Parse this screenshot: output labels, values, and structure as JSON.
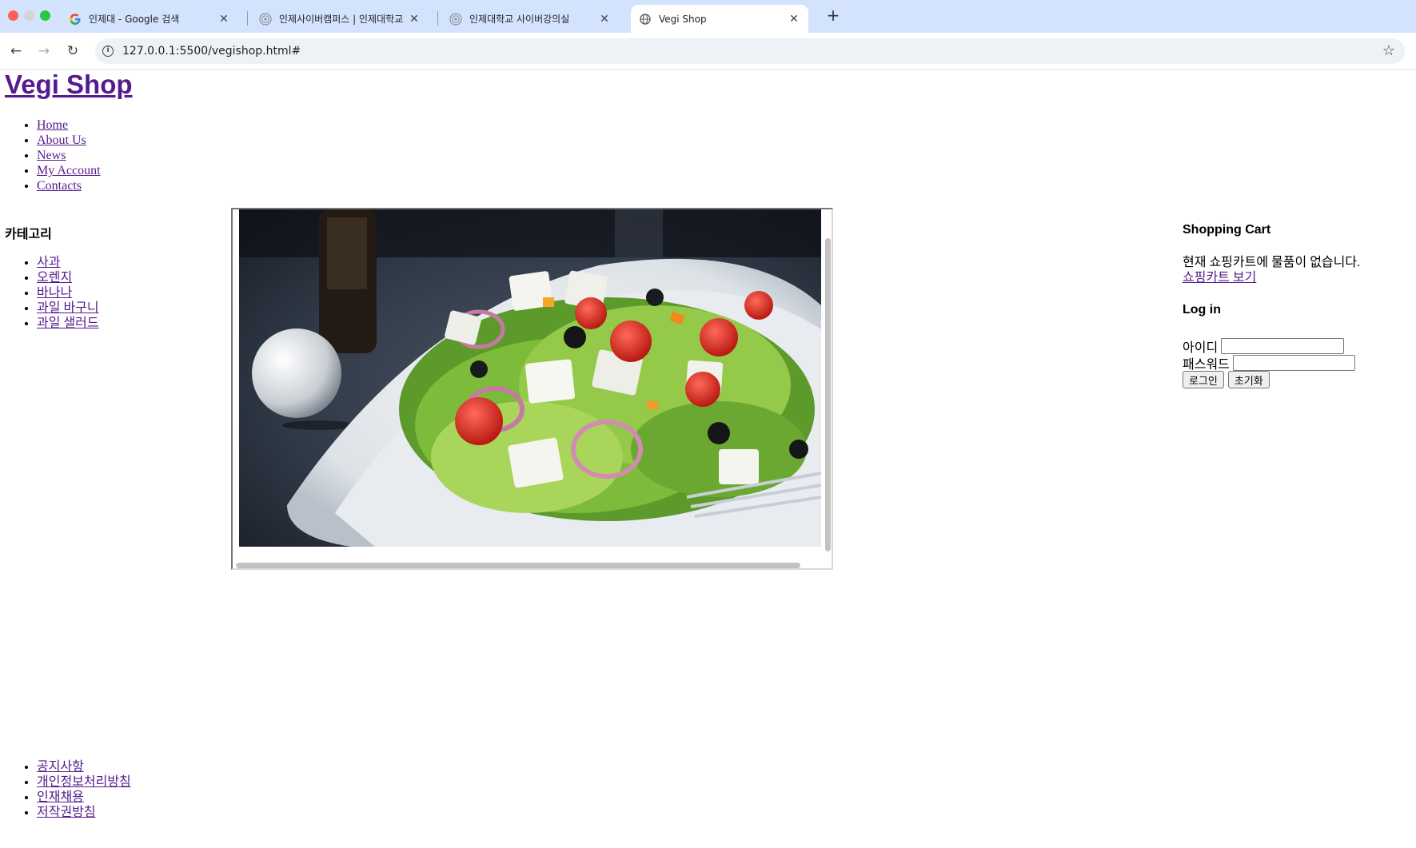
{
  "browser": {
    "tabs": [
      {
        "title": "인제대 - Google 검색",
        "icon": "google-g-icon",
        "active": false
      },
      {
        "title": "인제사이버캠퍼스 | 인제대학교",
        "icon": "university-seal-icon",
        "active": false
      },
      {
        "title": "인제대학교 사이버강의실",
        "icon": "university-seal-icon",
        "active": false
      },
      {
        "title": "Vegi Shop",
        "icon": "globe-icon",
        "active": true
      }
    ],
    "close_glyph": "✕",
    "new_tab_glyph": "+",
    "back_glyph": "←",
    "forward_glyph": "→",
    "reload_glyph": "↻",
    "info_glyph": "i",
    "bookmark_glyph": "☆",
    "url": "127.0.0.1:5500/vegishop.html#"
  },
  "site": {
    "title": "Vegi Shop",
    "nav": [
      "Home",
      "About Us",
      "News",
      "My Account",
      "Contacts"
    ]
  },
  "category": {
    "heading": "카테고리",
    "items": [
      "사과",
      "오렌지",
      "바나나",
      "과일 바구니",
      "과일 샐러드"
    ]
  },
  "cart": {
    "heading": "Shopping Cart",
    "empty_text": "현재 쇼핑카트에 물품이 없습니다.",
    "view_link": "쇼핑카트 보기"
  },
  "login": {
    "heading": "Log in",
    "id_label": "아이디",
    "pw_label": "패스워드",
    "id_value": "",
    "pw_value": "",
    "submit_label": "로그인",
    "reset_label": "초기화"
  },
  "footer": {
    "links": [
      "공지사항",
      "개인정보처리방침",
      "인재채용",
      "저작권방침"
    ]
  },
  "colors": {
    "tabbar_bg": "#d3e3fd",
    "link_visited": "#551a8b"
  }
}
